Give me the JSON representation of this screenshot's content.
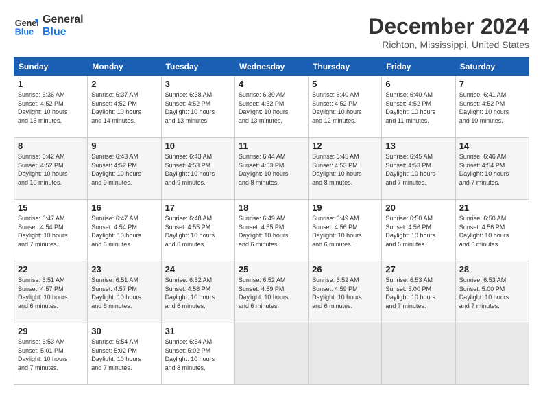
{
  "header": {
    "logo_line1": "General",
    "logo_line2": "Blue",
    "month": "December 2024",
    "location": "Richton, Mississippi, United States"
  },
  "weekdays": [
    "Sunday",
    "Monday",
    "Tuesday",
    "Wednesday",
    "Thursday",
    "Friday",
    "Saturday"
  ],
  "weeks": [
    [
      {
        "day": "1",
        "sunrise": "6:36 AM",
        "sunset": "4:52 PM",
        "daylight": "10 hours and 15 minutes."
      },
      {
        "day": "2",
        "sunrise": "6:37 AM",
        "sunset": "4:52 PM",
        "daylight": "10 hours and 14 minutes."
      },
      {
        "day": "3",
        "sunrise": "6:38 AM",
        "sunset": "4:52 PM",
        "daylight": "10 hours and 13 minutes."
      },
      {
        "day": "4",
        "sunrise": "6:39 AM",
        "sunset": "4:52 PM",
        "daylight": "10 hours and 13 minutes."
      },
      {
        "day": "5",
        "sunrise": "6:40 AM",
        "sunset": "4:52 PM",
        "daylight": "10 hours and 12 minutes."
      },
      {
        "day": "6",
        "sunrise": "6:40 AM",
        "sunset": "4:52 PM",
        "daylight": "10 hours and 11 minutes."
      },
      {
        "day": "7",
        "sunrise": "6:41 AM",
        "sunset": "4:52 PM",
        "daylight": "10 hours and 10 minutes."
      }
    ],
    [
      {
        "day": "8",
        "sunrise": "6:42 AM",
        "sunset": "4:52 PM",
        "daylight": "10 hours and 10 minutes."
      },
      {
        "day": "9",
        "sunrise": "6:43 AM",
        "sunset": "4:52 PM",
        "daylight": "10 hours and 9 minutes."
      },
      {
        "day": "10",
        "sunrise": "6:43 AM",
        "sunset": "4:53 PM",
        "daylight": "10 hours and 9 minutes."
      },
      {
        "day": "11",
        "sunrise": "6:44 AM",
        "sunset": "4:53 PM",
        "daylight": "10 hours and 8 minutes."
      },
      {
        "day": "12",
        "sunrise": "6:45 AM",
        "sunset": "4:53 PM",
        "daylight": "10 hours and 8 minutes."
      },
      {
        "day": "13",
        "sunrise": "6:45 AM",
        "sunset": "4:53 PM",
        "daylight": "10 hours and 7 minutes."
      },
      {
        "day": "14",
        "sunrise": "6:46 AM",
        "sunset": "4:54 PM",
        "daylight": "10 hours and 7 minutes."
      }
    ],
    [
      {
        "day": "15",
        "sunrise": "6:47 AM",
        "sunset": "4:54 PM",
        "daylight": "10 hours and 7 minutes."
      },
      {
        "day": "16",
        "sunrise": "6:47 AM",
        "sunset": "4:54 PM",
        "daylight": "10 hours and 6 minutes."
      },
      {
        "day": "17",
        "sunrise": "6:48 AM",
        "sunset": "4:55 PM",
        "daylight": "10 hours and 6 minutes."
      },
      {
        "day": "18",
        "sunrise": "6:49 AM",
        "sunset": "4:55 PM",
        "daylight": "10 hours and 6 minutes."
      },
      {
        "day": "19",
        "sunrise": "6:49 AM",
        "sunset": "4:56 PM",
        "daylight": "10 hours and 6 minutes."
      },
      {
        "day": "20",
        "sunrise": "6:50 AM",
        "sunset": "4:56 PM",
        "daylight": "10 hours and 6 minutes."
      },
      {
        "day": "21",
        "sunrise": "6:50 AM",
        "sunset": "4:56 PM",
        "daylight": "10 hours and 6 minutes."
      }
    ],
    [
      {
        "day": "22",
        "sunrise": "6:51 AM",
        "sunset": "4:57 PM",
        "daylight": "10 hours and 6 minutes."
      },
      {
        "day": "23",
        "sunrise": "6:51 AM",
        "sunset": "4:57 PM",
        "daylight": "10 hours and 6 minutes."
      },
      {
        "day": "24",
        "sunrise": "6:52 AM",
        "sunset": "4:58 PM",
        "daylight": "10 hours and 6 minutes."
      },
      {
        "day": "25",
        "sunrise": "6:52 AM",
        "sunset": "4:59 PM",
        "daylight": "10 hours and 6 minutes."
      },
      {
        "day": "26",
        "sunrise": "6:52 AM",
        "sunset": "4:59 PM",
        "daylight": "10 hours and 6 minutes."
      },
      {
        "day": "27",
        "sunrise": "6:53 AM",
        "sunset": "5:00 PM",
        "daylight": "10 hours and 7 minutes."
      },
      {
        "day": "28",
        "sunrise": "6:53 AM",
        "sunset": "5:00 PM",
        "daylight": "10 hours and 7 minutes."
      }
    ],
    [
      {
        "day": "29",
        "sunrise": "6:53 AM",
        "sunset": "5:01 PM",
        "daylight": "10 hours and 7 minutes."
      },
      {
        "day": "30",
        "sunrise": "6:54 AM",
        "sunset": "5:02 PM",
        "daylight": "10 hours and 7 minutes."
      },
      {
        "day": "31",
        "sunrise": "6:54 AM",
        "sunset": "5:02 PM",
        "daylight": "10 hours and 8 minutes."
      },
      null,
      null,
      null,
      null
    ]
  ],
  "labels": {
    "sunrise_prefix": "Sunrise: ",
    "sunset_prefix": "Sunset: ",
    "daylight_prefix": "Daylight: "
  }
}
